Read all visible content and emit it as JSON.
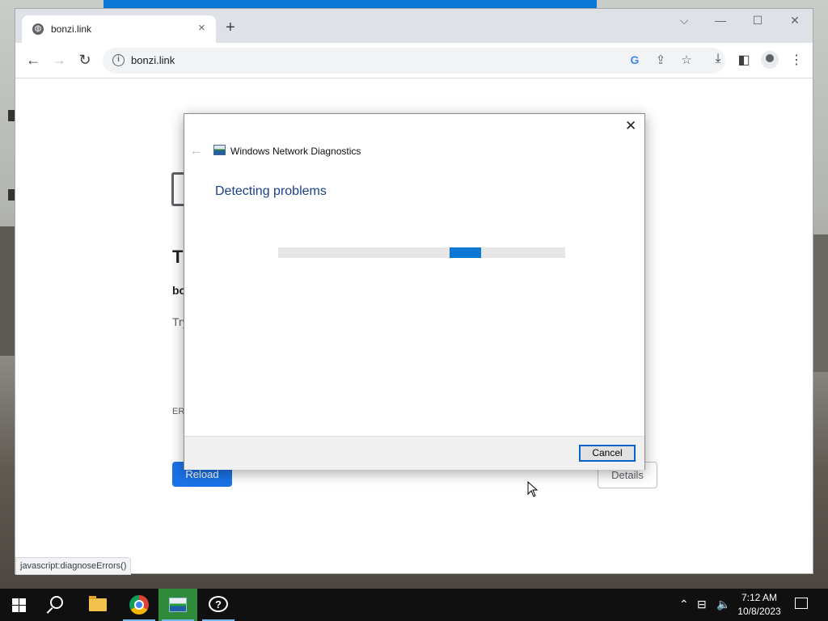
{
  "browser": {
    "tab_title": "bonzi.link",
    "tab_close": "×",
    "new_tab": "+",
    "url": "bonzi.link",
    "controls": {
      "chevron": "⌵",
      "minimize": "—",
      "maximize": "☐",
      "close": "✕"
    },
    "status_url": "javascript:diagnoseErrors()"
  },
  "page": {
    "heading_fragment": "T",
    "host_fragment": "bo",
    "try_fragment": "Try",
    "code_fragment": "ERI",
    "reload_label": "Reload",
    "details_label": "Details"
  },
  "dialog": {
    "title": "Windows Network Diagnostics",
    "heading": "Detecting problems",
    "cancel_label": "Cancel",
    "progress_indicator": "indeterminate"
  },
  "taskbar": {
    "time": "7:12 AM",
    "date": "10/8/2023",
    "apps": [
      "start-icon",
      "search-icon",
      "file-explorer-icon",
      "chrome-icon",
      "network-diagnostics-icon",
      "get-help-icon"
    ]
  },
  "colors": {
    "accent": "#0a78d4",
    "chrome_blue": "#1a73e8",
    "dialog_heading": "#1b3f8a"
  }
}
